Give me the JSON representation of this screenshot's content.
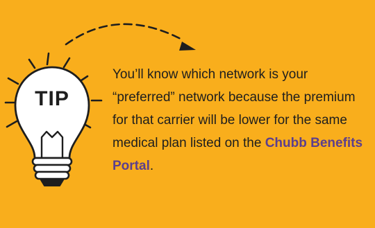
{
  "tip": {
    "label": "TIP",
    "body_before_link": "You’ll know which network is your “preferred” network because the premium for that carrier will be lower for the same medical plan listed on the ",
    "link_text": "Chubb Benefits Portal",
    "body_after_link": "."
  },
  "icons": {
    "bulb": "lightbulb-icon",
    "arrow": "dashed-curved-arrow-icon"
  },
  "colors": {
    "background": "#f9ae1c",
    "text": "#1e1e1e",
    "link": "#5c3f8d",
    "bulb_fill": "#ffffff",
    "outline": "#1e1e1e"
  }
}
